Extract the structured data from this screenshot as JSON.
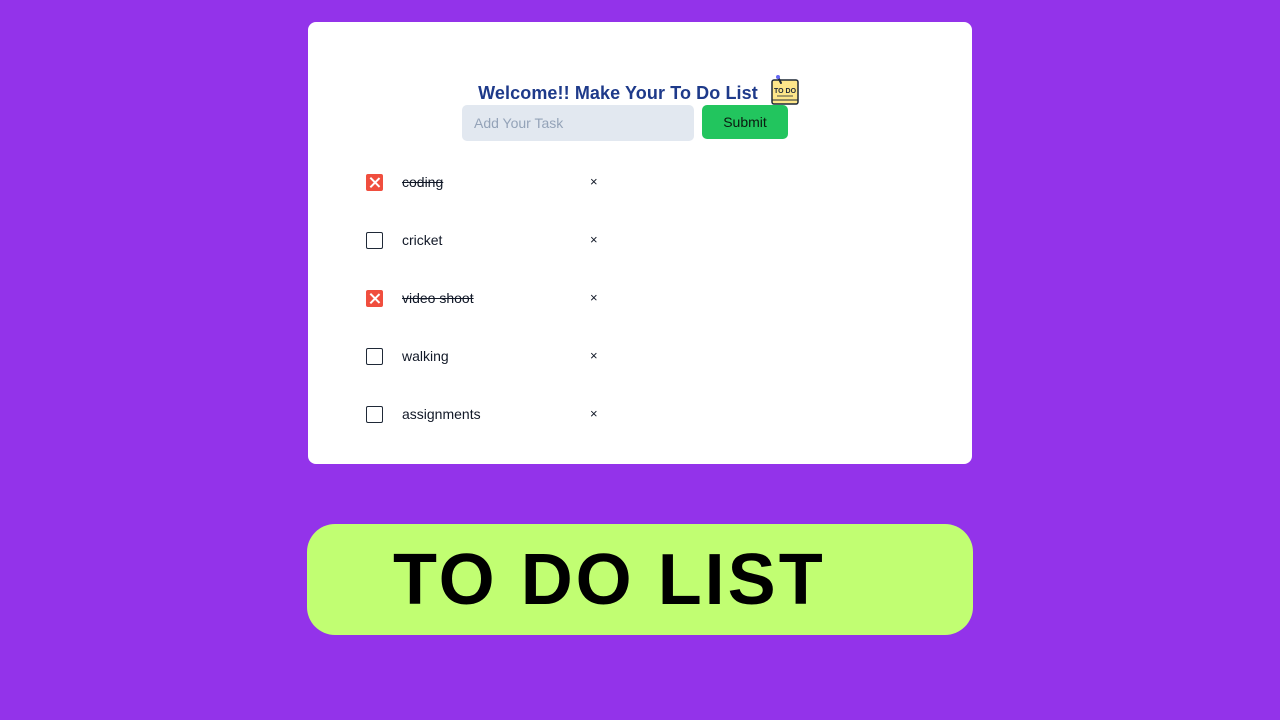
{
  "app": {
    "title": "Welcome!! Make Your To Do List",
    "title_icon": "todo-note-icon",
    "title_icon_text": "TO DO"
  },
  "form": {
    "input_value": "",
    "input_placeholder": "Add Your Task",
    "submit_label": "Submit"
  },
  "tasks": [
    {
      "label": "coding",
      "checked": true,
      "delete_label": "×"
    },
    {
      "label": "cricket",
      "checked": false,
      "delete_label": "×"
    },
    {
      "label": "video shoot",
      "checked": true,
      "delete_label": "×"
    },
    {
      "label": "walking",
      "checked": false,
      "delete_label": "×"
    },
    {
      "label": "assignments",
      "checked": false,
      "delete_label": "×"
    }
  ],
  "banner": {
    "text": "TO DO LIST"
  },
  "colors": {
    "background": "#9333ea",
    "title": "#1e3a8a",
    "submit": "#22c55e",
    "checked": "#f04e3e",
    "banner": "#c1fe72"
  }
}
